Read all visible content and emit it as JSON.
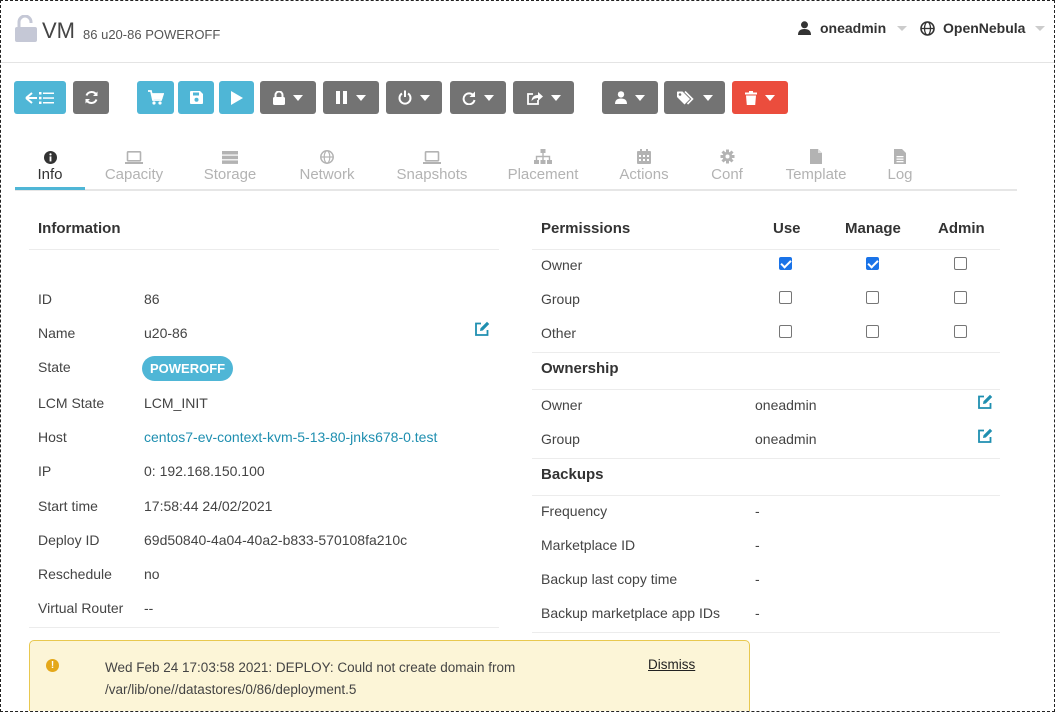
{
  "header": {
    "title": "VM",
    "vm_id": "86",
    "vm_name": "u20-86",
    "vm_state": "POWEROFF",
    "user": "oneadmin",
    "zone": "OpenNebula"
  },
  "tabs": [
    {
      "label": "Info",
      "icon": "info-icon",
      "active": true
    },
    {
      "label": "Capacity",
      "icon": "laptop-icon"
    },
    {
      "label": "Storage",
      "icon": "storage-icon"
    },
    {
      "label": "Network",
      "icon": "globe-icon"
    },
    {
      "label": "Snapshots",
      "icon": "laptop-icon"
    },
    {
      "label": "Placement",
      "icon": "sitemap-icon"
    },
    {
      "label": "Actions",
      "icon": "calendar-icon"
    },
    {
      "label": "Conf",
      "icon": "gear-icon"
    },
    {
      "label": "Template",
      "icon": "file-icon"
    },
    {
      "label": "Log",
      "icon": "file-text-icon"
    }
  ],
  "information": {
    "title": "Information",
    "rows": [
      {
        "label": "ID",
        "value": "86"
      },
      {
        "label": "Name",
        "value": "u20-86"
      },
      {
        "label": "State",
        "value": "POWEROFF"
      },
      {
        "label": "LCM State",
        "value": "LCM_INIT"
      },
      {
        "label": "Host",
        "value": "centos7-ev-context-kvm-5-13-80-jnks678-0.test"
      },
      {
        "label": "IP",
        "value": "0: 192.168.150.100"
      },
      {
        "label": "Start time",
        "value": "17:58:44 24/02/2021"
      },
      {
        "label": "Deploy ID",
        "value": "69d50840-4a04-40a2-b833-570108fa210c"
      },
      {
        "label": "Reschedule",
        "value": "no"
      },
      {
        "label": "Virtual Router",
        "value": "--"
      }
    ]
  },
  "permissions": {
    "title": "Permissions",
    "columns": [
      "Use",
      "Manage",
      "Admin"
    ],
    "rows": [
      {
        "label": "Owner",
        "use": true,
        "manage": true,
        "admin": false
      },
      {
        "label": "Group",
        "use": false,
        "manage": false,
        "admin": false
      },
      {
        "label": "Other",
        "use": false,
        "manage": false,
        "admin": false
      }
    ]
  },
  "ownership": {
    "title": "Ownership",
    "rows": [
      {
        "label": "Owner",
        "value": "oneadmin"
      },
      {
        "label": "Group",
        "value": "oneadmin"
      }
    ]
  },
  "backups": {
    "title": "Backups",
    "rows": [
      {
        "label": "Frequency",
        "value": "-"
      },
      {
        "label": "Marketplace ID",
        "value": "-"
      },
      {
        "label": "Backup last copy time",
        "value": "-"
      },
      {
        "label": "Backup marketplace app IDs",
        "value": "-"
      }
    ]
  },
  "alert": {
    "message": "Wed Feb 24 17:03:58 2021: DEPLOY: Could not create domain from /var/lib/one//datastores/0/86/deployment.5",
    "dismiss": "Dismiss"
  },
  "colors": {
    "accent": "#4fb6d6",
    "toolbar_gray": "#737373",
    "danger": "#eb4d3d",
    "link": "#1f8fb0",
    "alert_bg": "#fcf5d7"
  }
}
